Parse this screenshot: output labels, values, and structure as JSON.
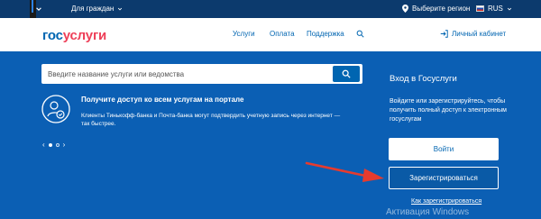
{
  "topbar": {
    "citizens_label": "Для граждан",
    "region_label": "Выберите регион",
    "lang_label": "RUS"
  },
  "header": {
    "logo_gos": "гос",
    "logo_uslugi": "услуги",
    "nav": [
      "Услуги",
      "Оплата",
      "Поддержка"
    ],
    "cabinet_label": "Личный кабинет"
  },
  "search": {
    "placeholder": "Введите название услуги или ведомства"
  },
  "promo": {
    "title": "Получите доступ ко всем услугам на портале",
    "text": "Клиенты Тинькофф-банка и Почта-банка могут подтвердить учетную запись через интернет — так быстрее."
  },
  "carousel": {
    "prev": "‹",
    "next": "›"
  },
  "login_panel": {
    "title": "Вход в Госуслуги",
    "text": "Войдите или зарегистрируйтесь, чтобы получить полный доступ к электронным госуслугам",
    "login_button": "Войти",
    "register_button": "Зарегистрироваться",
    "how_register_link": "Как зарегистрироваться"
  },
  "overlay": {
    "watermark": "Активация Windows",
    "arrow_color": "#e63b2e"
  },
  "colors": {
    "brand_blue": "#0065b1",
    "brand_red": "#ee3f58",
    "topbar": "#0c3a6d",
    "background": "#0b5fb4"
  }
}
